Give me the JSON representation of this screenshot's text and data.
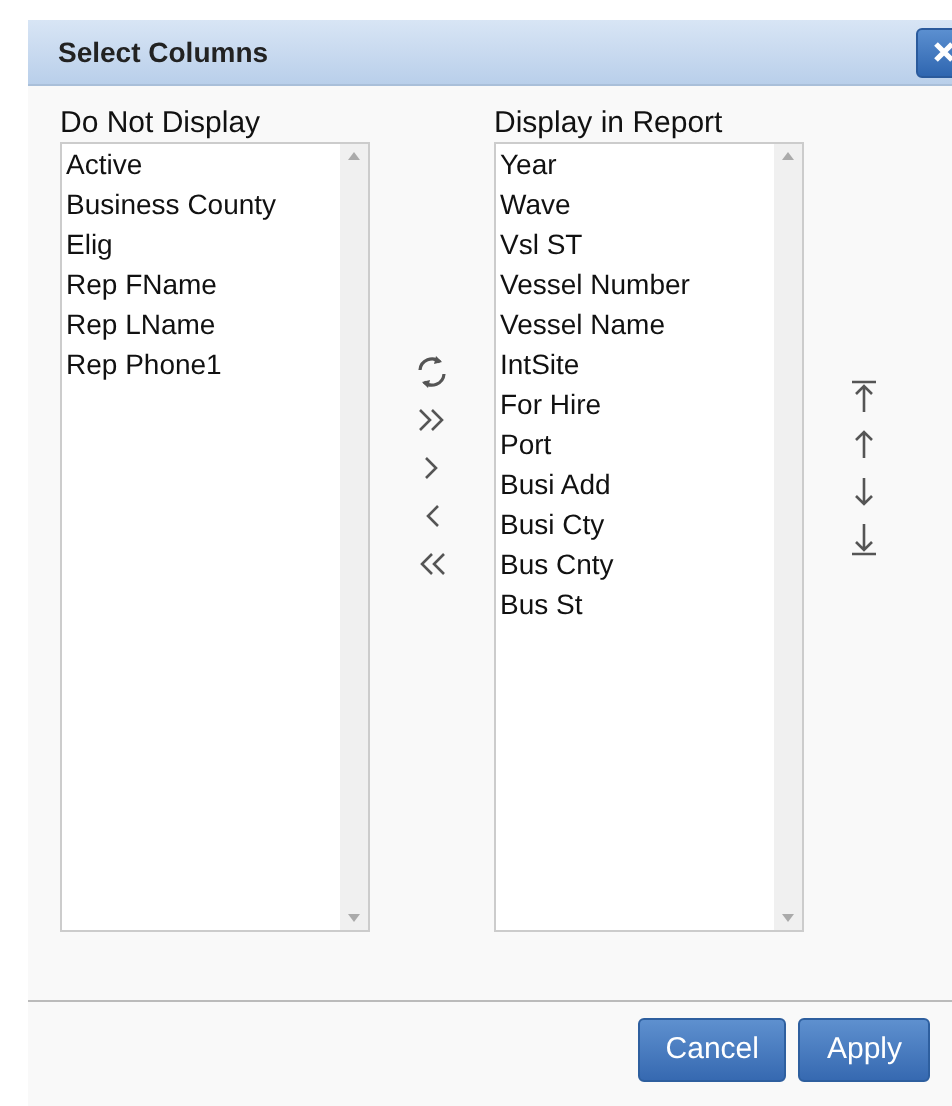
{
  "dialog": {
    "title": "Select Columns"
  },
  "lists": [
    {
      "label": "Do Not Display",
      "items": [
        "Active",
        "Business County",
        "Elig",
        "Rep FName",
        "Rep LName",
        "Rep Phone1"
      ]
    },
    {
      "label": "Display in Report",
      "items": [
        "Year",
        "Wave",
        "Vsl ST",
        "Vessel Number",
        "Vessel Name",
        "IntSite",
        "For Hire",
        "Port",
        "Busi Add",
        "Busi Cty",
        "Bus Cnty",
        "Bus St"
      ]
    }
  ],
  "transfer_buttons": [
    {
      "kind": "reset"
    },
    {
      "kind": "all-right"
    },
    {
      "kind": "right"
    },
    {
      "kind": "left"
    },
    {
      "kind": "all-left"
    }
  ],
  "order_buttons": [
    {
      "kind": "top"
    },
    {
      "kind": "up"
    },
    {
      "kind": "down"
    },
    {
      "kind": "bottom"
    }
  ],
  "buttons": [
    "Cancel",
    "Apply"
  ]
}
